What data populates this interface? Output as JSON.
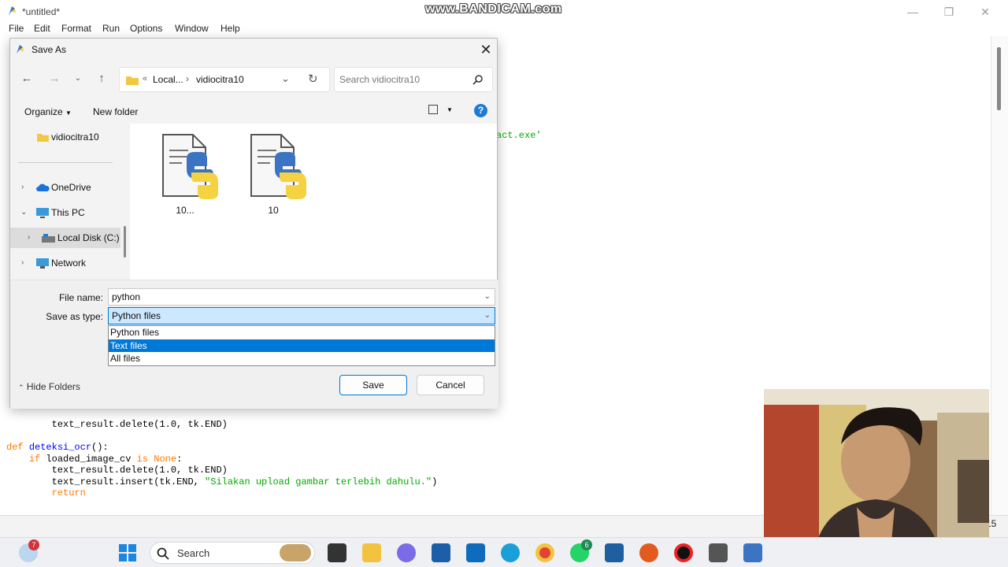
{
  "idle": {
    "title": "*untitled*",
    "menus": [
      "File",
      "Edit",
      "Format",
      "Run",
      "Options",
      "Window",
      "Help"
    ],
    "code_right_fragment": "act.exe'",
    "code_lines": [
      {
        "indent": "    ",
        "text": "text_result.delete(1.0, tk.END)"
      },
      {
        "kw": "def",
        "fn": "deteksi_ocr",
        "rest": "():"
      },
      {
        "indent": "    ",
        "kw": "if",
        "rest": " loaded_image_cv ",
        "kw2": "is",
        "rest2": " ",
        "kw3": "None",
        "rest3": ":"
      },
      {
        "indent": "        ",
        "text": "text_result.delete(1.0, tk.END)"
      },
      {
        "indent": "        ",
        "pre": "text_result.insert(tk.END, ",
        "str": "\"Silakan upload gambar terlebih dahulu.\"",
        "post": ")"
      },
      {
        "indent": "        ",
        "kw": "return"
      }
    ],
    "status_col": "15"
  },
  "watermark": "www.BANDICAM.com",
  "dialog": {
    "title": "Save As",
    "close_label": "✕",
    "address": {
      "prefix": "«",
      "crumb1": "Local...",
      "sep": "›",
      "crumb2": "vidiocitra10"
    },
    "search_placeholder": "Search vidiocitra10",
    "toolbar": {
      "organize": "Organize",
      "new_folder": "New folder"
    },
    "nav": {
      "pinned_folder": "vidiocitra10",
      "items": [
        {
          "label": "OneDrive",
          "expanded": false
        },
        {
          "label": "This PC",
          "expanded": true
        },
        {
          "label": "Local Disk (C:)",
          "expanded": false,
          "selected": true
        },
        {
          "label": "Network",
          "expanded": false
        }
      ]
    },
    "files": [
      {
        "name": "10..."
      },
      {
        "name": "10"
      }
    ],
    "file_name_label": "File name:",
    "file_name_value": "python",
    "save_type_label": "Save as type:",
    "save_type_value": "Python files",
    "type_options": [
      {
        "label": "Python files",
        "highlighted": false
      },
      {
        "label": "Text files",
        "highlighted": true
      },
      {
        "label": "All files",
        "highlighted": false
      }
    ],
    "hide_folders": "Hide Folders",
    "save_label": "Save",
    "cancel_label": "Cancel"
  },
  "taskbar": {
    "weather_badge": "7",
    "search_label": "Search",
    "whatsapp_badge": "6"
  },
  "colors": {
    "accent": "#0078d4",
    "selection": "#cce8ff",
    "highlight": "#0078d7"
  }
}
